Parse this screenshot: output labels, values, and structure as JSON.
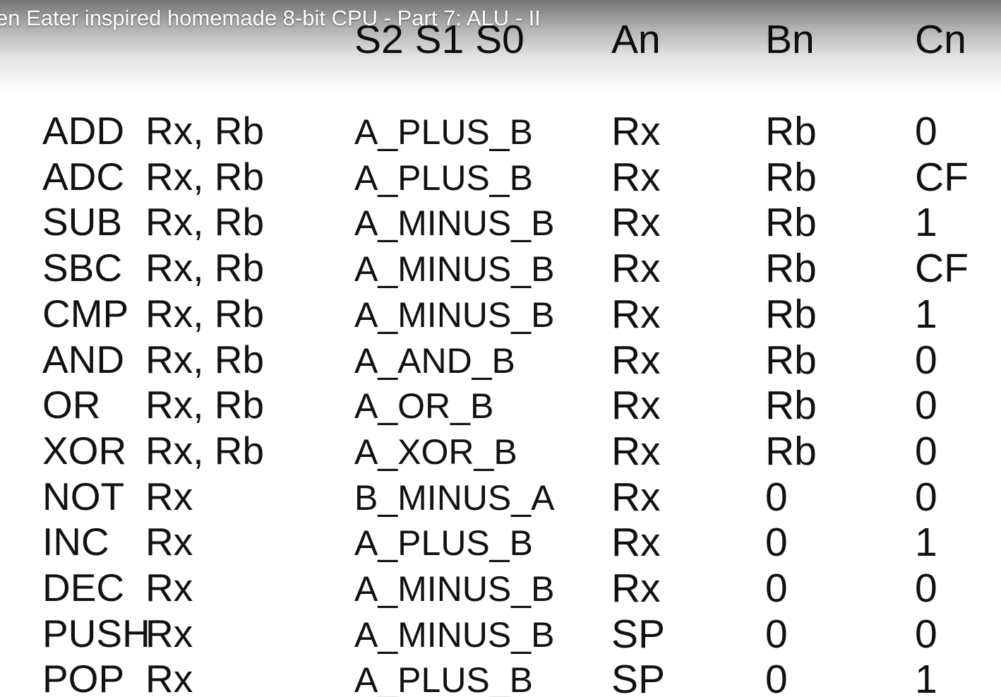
{
  "video": {
    "title": "en Eater inspired homemade 8-bit CPU - Part 7: ALU - II"
  },
  "table": {
    "headers": {
      "s": "S2 S1 S0",
      "an": "An",
      "bn": "Bn",
      "cn": "Cn"
    },
    "rows": [
      {
        "mn": "ADD",
        "args": "Rx, Rb",
        "alu": "A_PLUS_B",
        "an": "Rx",
        "bn": "Rb",
        "cn": "0"
      },
      {
        "mn": "ADC",
        "args": "Rx, Rb",
        "alu": "A_PLUS_B",
        "an": "Rx",
        "bn": "Rb",
        "cn": "CF"
      },
      {
        "mn": "SUB",
        "args": "Rx, Rb",
        "alu": "A_MINUS_B",
        "an": "Rx",
        "bn": "Rb",
        "cn": "1"
      },
      {
        "mn": "SBC",
        "args": "Rx, Rb",
        "alu": "A_MINUS_B",
        "an": "Rx",
        "bn": "Rb",
        "cn": "CF"
      },
      {
        "mn": "CMP",
        "args": "Rx, Rb",
        "alu": "A_MINUS_B",
        "an": "Rx",
        "bn": "Rb",
        "cn": "1"
      },
      {
        "mn": "AND",
        "args": "Rx, Rb",
        "alu": "A_AND_B",
        "an": "Rx",
        "bn": "Rb",
        "cn": "0"
      },
      {
        "mn": "OR",
        "args": "Rx, Rb",
        "alu": "A_OR_B",
        "an": "Rx",
        "bn": "Rb",
        "cn": "0"
      },
      {
        "mn": "XOR",
        "args": "Rx, Rb",
        "alu": "A_XOR_B",
        "an": "Rx",
        "bn": "Rb",
        "cn": "0"
      },
      {
        "mn": "NOT",
        "args": "Rx",
        "alu": "B_MINUS_A",
        "an": "Rx",
        "bn": "0",
        "cn": "0"
      },
      {
        "mn": "INC",
        "args": "Rx",
        "alu": "A_PLUS_B",
        "an": "Rx",
        "bn": "0",
        "cn": "1"
      },
      {
        "mn": "DEC",
        "args": "Rx",
        "alu": "A_MINUS_B",
        "an": "Rx",
        "bn": "0",
        "cn": "0"
      },
      {
        "mn": "PUSH",
        "args": "Rx",
        "alu": "A_MINUS_B",
        "an": "SP",
        "bn": "0",
        "cn": "0"
      },
      {
        "mn": "POP",
        "args": "Rx",
        "alu": "A_PLUS_B",
        "an": "SP",
        "bn": "0",
        "cn": "1"
      }
    ]
  }
}
